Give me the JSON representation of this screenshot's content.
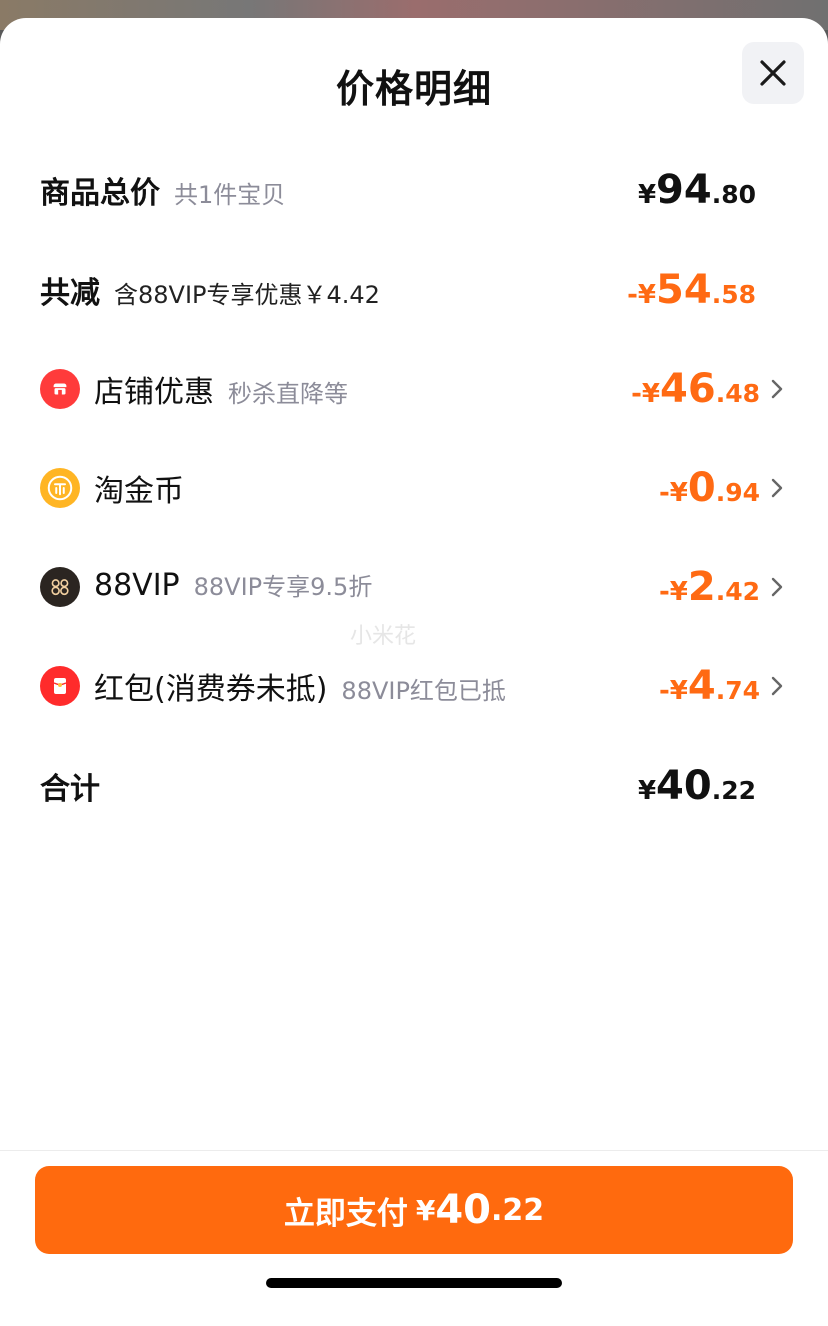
{
  "sheet": {
    "title": "价格明细"
  },
  "rows": [
    {
      "label": "商品总价",
      "note": "共1件宝贝",
      "amount": {
        "symbol": "¥",
        "int": "94",
        "dec": ".80"
      }
    },
    {
      "label": "共减",
      "note": "含88VIP专享优惠￥4.42",
      "amount": {
        "symbol": "-¥",
        "int": "54",
        "dec": ".58"
      }
    },
    {
      "label": "店铺优惠",
      "note": "秒杀直降等",
      "icon": "shop-coupon-icon",
      "amount": {
        "symbol": "-¥",
        "int": "46",
        "dec": ".48"
      }
    },
    {
      "label": "淘金币",
      "note": "",
      "icon": "coin-icon",
      "amount": {
        "symbol": "-¥",
        "int": "0",
        "dec": ".94"
      }
    },
    {
      "label": "88VIP",
      "note": "88VIP专享9.5折",
      "icon": "vip88-icon",
      "amount": {
        "symbol": "-¥",
        "int": "2",
        "dec": ".42"
      }
    },
    {
      "label": "红包(消费券未抵)",
      "note": "88VIP红包已抵",
      "icon": "red-packet-icon",
      "amount": {
        "symbol": "-¥",
        "int": "4",
        "dec": ".74"
      }
    },
    {
      "label": "合计",
      "note": "",
      "amount": {
        "symbol": "¥",
        "int": "40",
        "dec": ".22"
      }
    }
  ],
  "watermark": "小米花",
  "pay_button": {
    "label": "立即支付",
    "symbol": "¥",
    "int": "40",
    "dec": ".22"
  },
  "colors": {
    "accent": "#ff6a13",
    "button": "#ff6a0e",
    "text": "#111111",
    "muted": "#8c8c99"
  }
}
